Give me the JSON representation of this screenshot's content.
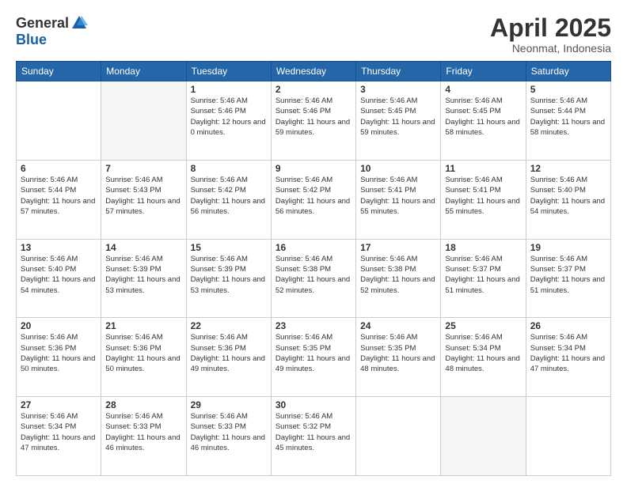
{
  "header": {
    "logo_general": "General",
    "logo_blue": "Blue",
    "month_title": "April 2025",
    "location": "Neonmat, Indonesia"
  },
  "days_of_week": [
    "Sunday",
    "Monday",
    "Tuesday",
    "Wednesday",
    "Thursday",
    "Friday",
    "Saturday"
  ],
  "weeks": [
    [
      {
        "day": "",
        "empty": true
      },
      {
        "day": "",
        "empty": true
      },
      {
        "day": "1",
        "sunrise": "5:46 AM",
        "sunset": "5:46 PM",
        "daylight": "12 hours and 0 minutes."
      },
      {
        "day": "2",
        "sunrise": "5:46 AM",
        "sunset": "5:46 PM",
        "daylight": "11 hours and 59 minutes."
      },
      {
        "day": "3",
        "sunrise": "5:46 AM",
        "sunset": "5:45 PM",
        "daylight": "11 hours and 59 minutes."
      },
      {
        "day": "4",
        "sunrise": "5:46 AM",
        "sunset": "5:45 PM",
        "daylight": "11 hours and 58 minutes."
      },
      {
        "day": "5",
        "sunrise": "5:46 AM",
        "sunset": "5:44 PM",
        "daylight": "11 hours and 58 minutes."
      }
    ],
    [
      {
        "day": "6",
        "sunrise": "5:46 AM",
        "sunset": "5:44 PM",
        "daylight": "11 hours and 57 minutes."
      },
      {
        "day": "7",
        "sunrise": "5:46 AM",
        "sunset": "5:43 PM",
        "daylight": "11 hours and 57 minutes."
      },
      {
        "day": "8",
        "sunrise": "5:46 AM",
        "sunset": "5:42 PM",
        "daylight": "11 hours and 56 minutes."
      },
      {
        "day": "9",
        "sunrise": "5:46 AM",
        "sunset": "5:42 PM",
        "daylight": "11 hours and 56 minutes."
      },
      {
        "day": "10",
        "sunrise": "5:46 AM",
        "sunset": "5:41 PM",
        "daylight": "11 hours and 55 minutes."
      },
      {
        "day": "11",
        "sunrise": "5:46 AM",
        "sunset": "5:41 PM",
        "daylight": "11 hours and 55 minutes."
      },
      {
        "day": "12",
        "sunrise": "5:46 AM",
        "sunset": "5:40 PM",
        "daylight": "11 hours and 54 minutes."
      }
    ],
    [
      {
        "day": "13",
        "sunrise": "5:46 AM",
        "sunset": "5:40 PM",
        "daylight": "11 hours and 54 minutes."
      },
      {
        "day": "14",
        "sunrise": "5:46 AM",
        "sunset": "5:39 PM",
        "daylight": "11 hours and 53 minutes."
      },
      {
        "day": "15",
        "sunrise": "5:46 AM",
        "sunset": "5:39 PM",
        "daylight": "11 hours and 53 minutes."
      },
      {
        "day": "16",
        "sunrise": "5:46 AM",
        "sunset": "5:38 PM",
        "daylight": "11 hours and 52 minutes."
      },
      {
        "day": "17",
        "sunrise": "5:46 AM",
        "sunset": "5:38 PM",
        "daylight": "11 hours and 52 minutes."
      },
      {
        "day": "18",
        "sunrise": "5:46 AM",
        "sunset": "5:37 PM",
        "daylight": "11 hours and 51 minutes."
      },
      {
        "day": "19",
        "sunrise": "5:46 AM",
        "sunset": "5:37 PM",
        "daylight": "11 hours and 51 minutes."
      }
    ],
    [
      {
        "day": "20",
        "sunrise": "5:46 AM",
        "sunset": "5:36 PM",
        "daylight": "11 hours and 50 minutes."
      },
      {
        "day": "21",
        "sunrise": "5:46 AM",
        "sunset": "5:36 PM",
        "daylight": "11 hours and 50 minutes."
      },
      {
        "day": "22",
        "sunrise": "5:46 AM",
        "sunset": "5:36 PM",
        "daylight": "11 hours and 49 minutes."
      },
      {
        "day": "23",
        "sunrise": "5:46 AM",
        "sunset": "5:35 PM",
        "daylight": "11 hours and 49 minutes."
      },
      {
        "day": "24",
        "sunrise": "5:46 AM",
        "sunset": "5:35 PM",
        "daylight": "11 hours and 48 minutes."
      },
      {
        "day": "25",
        "sunrise": "5:46 AM",
        "sunset": "5:34 PM",
        "daylight": "11 hours and 48 minutes."
      },
      {
        "day": "26",
        "sunrise": "5:46 AM",
        "sunset": "5:34 PM",
        "daylight": "11 hours and 47 minutes."
      }
    ],
    [
      {
        "day": "27",
        "sunrise": "5:46 AM",
        "sunset": "5:34 PM",
        "daylight": "11 hours and 47 minutes."
      },
      {
        "day": "28",
        "sunrise": "5:46 AM",
        "sunset": "5:33 PM",
        "daylight": "11 hours and 46 minutes."
      },
      {
        "day": "29",
        "sunrise": "5:46 AM",
        "sunset": "5:33 PM",
        "daylight": "11 hours and 46 minutes."
      },
      {
        "day": "30",
        "sunrise": "5:46 AM",
        "sunset": "5:32 PM",
        "daylight": "11 hours and 45 minutes."
      },
      {
        "day": "",
        "empty": true
      },
      {
        "day": "",
        "empty": true
      },
      {
        "day": "",
        "empty": true
      }
    ]
  ]
}
